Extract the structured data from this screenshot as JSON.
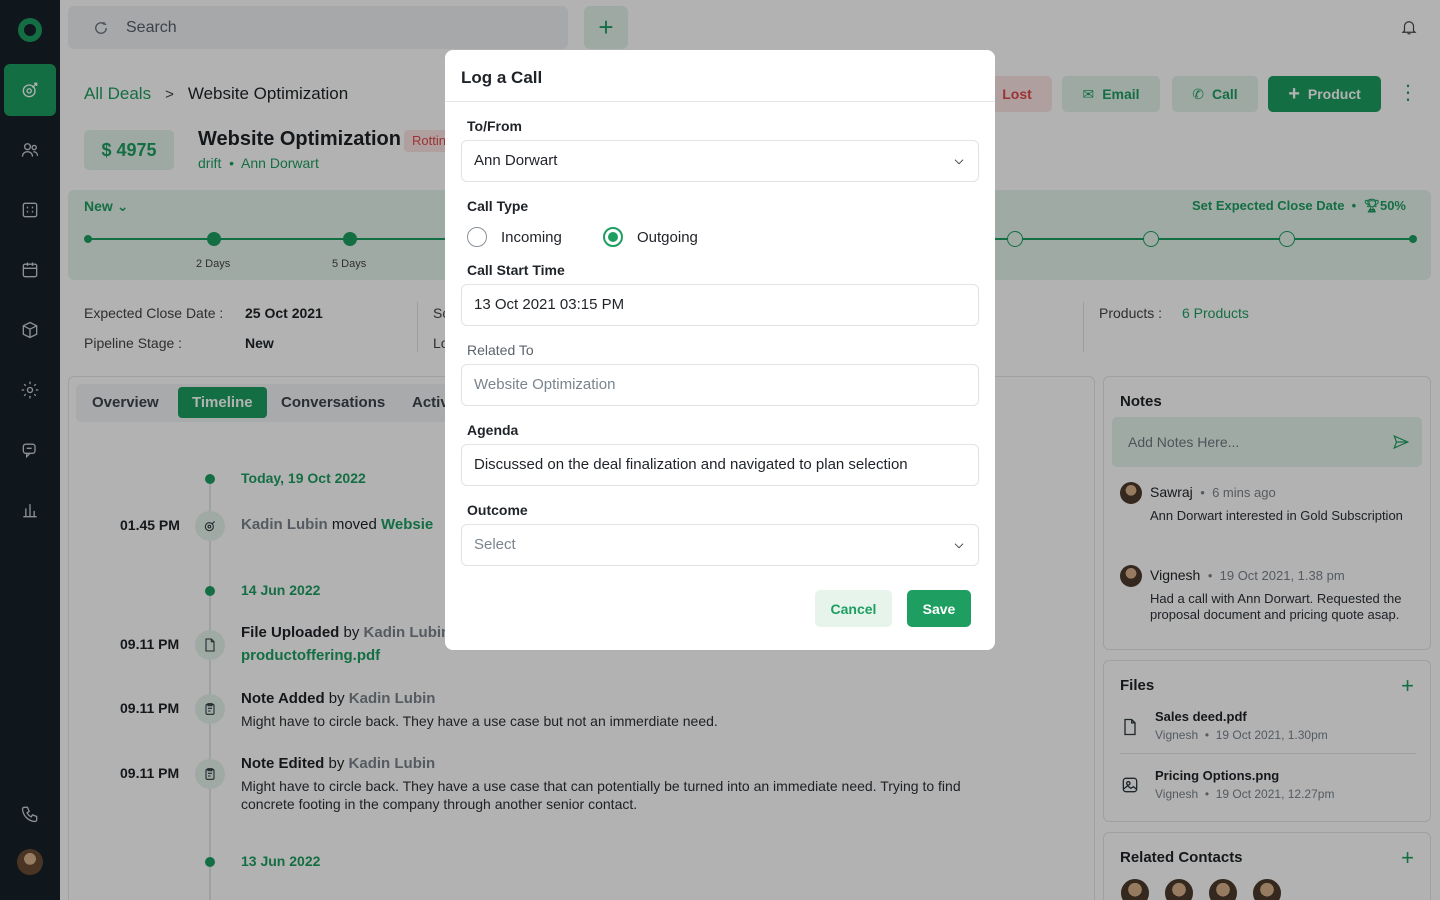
{
  "search": {
    "placeholder": "Search"
  },
  "breadcrumb": {
    "root": "All Deals",
    "current": "Website Optimization"
  },
  "actions": {
    "lost": "Lost",
    "email": "Email",
    "call": "Call",
    "product": "Product"
  },
  "deal": {
    "amount": "$ 4975",
    "title": "Website Optimization",
    "badge": "Rotting",
    "org": "drift",
    "contact": "Ann Dorwart",
    "stage_label": "New",
    "expected_close_link": "Set Expected Close Date",
    "probability": "50%",
    "stage_days": [
      "2 Days",
      "5 Days"
    ],
    "details": {
      "expected_close_label": "Expected Close Date :",
      "expected_close_value": "25 Oct 2021",
      "pipeline_stage_label": "Pipeline Stage :",
      "pipeline_stage_value": "New",
      "col2_label1": "Sc",
      "col2_label2": "Lo",
      "products_label": "Products :",
      "products_value": "6 Products"
    }
  },
  "tabs": [
    "Overview",
    "Timeline",
    "Conversations",
    "Activ"
  ],
  "timeline": {
    "date1": "Today, 19 Oct 2022",
    "e1": {
      "time": "01.45 PM",
      "actor": "Kadin Lubin",
      "verb": "moved",
      "target": "Websie"
    },
    "date2": "14 Jun 2022",
    "e2": {
      "time": "09.11 PM",
      "title": "File Uploaded",
      "by": "by",
      "actor": "Kadin Lubin",
      "file": "productoffering.pdf"
    },
    "e3": {
      "time": "09.11 PM",
      "title": "Note Added",
      "by": "by",
      "actor": "Kadin Lubin",
      "body": "Might have to circle back. They have a use case but not an immerdiate need."
    },
    "e4": {
      "time": "09.11 PM",
      "title": "Note Edited",
      "by": "by",
      "actor": "Kadin Lubin",
      "body": "Might have to circle back. They have a use case that can potentially be turned into an immediate need. Trying to find concrete footing in the company through another senior contact."
    },
    "date3": "13 Jun 2022"
  },
  "notes": {
    "title": "Notes",
    "placeholder": "Add Notes Here...",
    "items": [
      {
        "author": "Sawraj",
        "time": "6 mins ago",
        "text": "Ann Dorwart interested in Gold Subscription"
      },
      {
        "author": "Vignesh",
        "time": "19 Oct 2021, 1.38 pm",
        "text": "Had a call with Ann Dorwart. Requested the proposal document and pricing quote asap."
      }
    ]
  },
  "files": {
    "title": "Files",
    "items": [
      {
        "name": "Sales deed.pdf",
        "author": "Vignesh",
        "time": "19 Oct 2021, 1.30pm"
      },
      {
        "name": "Pricing Options.png",
        "author": "Vignesh",
        "time": "19 Oct 2021, 12.27pm"
      }
    ]
  },
  "related_contacts": {
    "title": "Related Contacts"
  },
  "modal": {
    "title": "Log a Call",
    "to_from_label": "To/From",
    "to_from_value": "Ann Dorwart",
    "call_type_label": "Call Type",
    "incoming": "Incoming",
    "outgoing": "Outgoing",
    "start_label": "Call Start Time",
    "start_value": "13 Oct 2021 03:15 PM",
    "related_label": "Related To",
    "related_placeholder": "Website Optimization",
    "agenda_label": "Agenda",
    "agenda_value": "Discussed on the deal finalization and navigated to plan selection",
    "outcome_label": "Outcome",
    "outcome_placeholder": "Select",
    "cancel": "Cancel",
    "save": "Save"
  },
  "colors": {
    "accent": "#1e9e60",
    "rail": "#16212a",
    "danger": "#e04a4a"
  }
}
